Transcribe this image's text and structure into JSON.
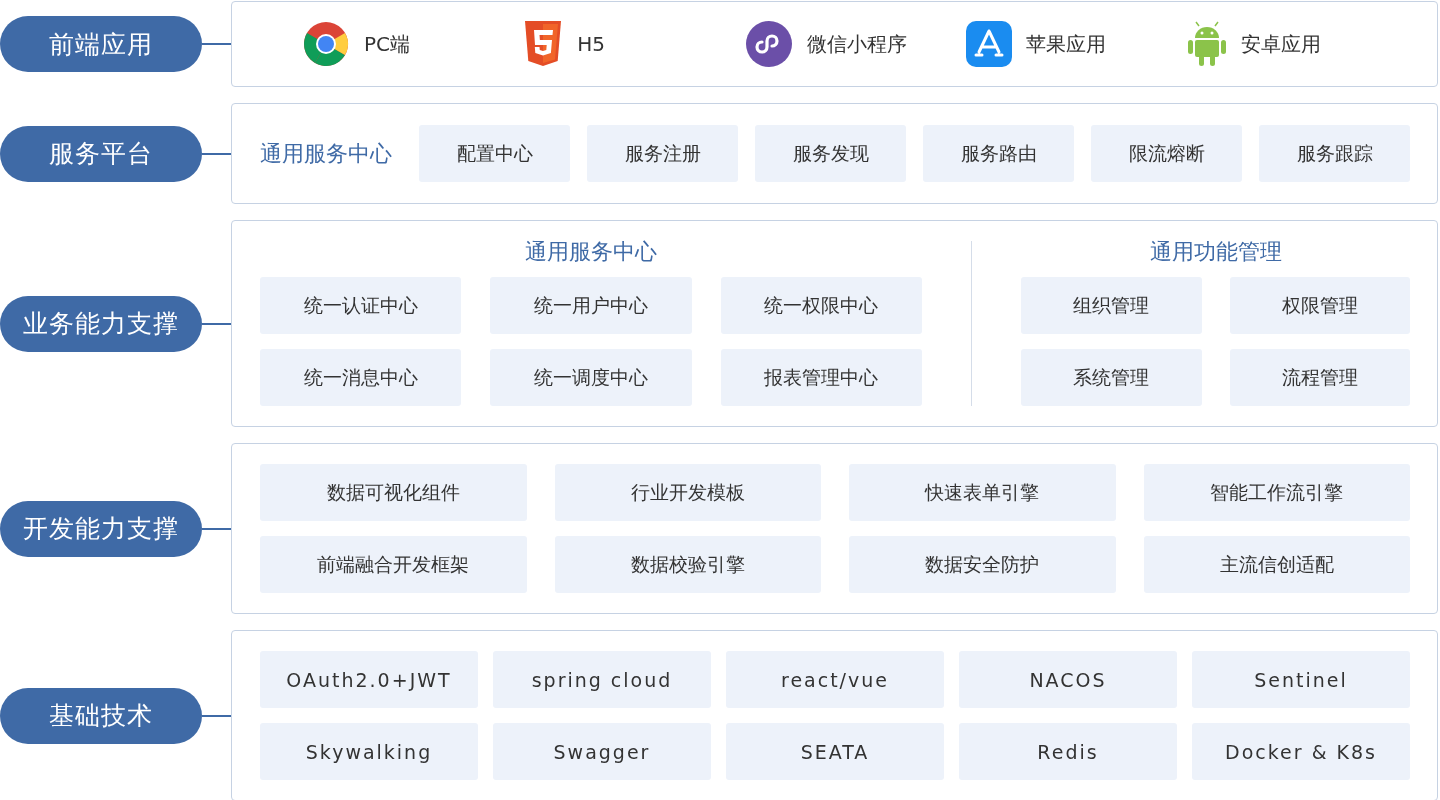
{
  "layers": [
    {
      "kind": "platforms",
      "label": "前端应用",
      "items": [
        "PC端",
        "H5",
        "微信小程序",
        "苹果应用",
        "安卓应用"
      ]
    },
    {
      "kind": "service",
      "label": "服务平台",
      "heading": "通用服务中心",
      "items": [
        "配置中心",
        "服务注册",
        "服务发现",
        "服务路由",
        "限流熔断",
        "服务跟踪"
      ]
    },
    {
      "kind": "business",
      "label": "业务能力支撑",
      "groups": [
        {
          "title": "通用服务中心",
          "items": [
            "统一认证中心",
            "统一用户中心",
            "统一权限中心",
            "统一消息中心",
            "统一调度中心",
            "报表管理中心"
          ]
        },
        {
          "title": "通用功能管理",
          "items": [
            "组织管理",
            "权限管理",
            "系统管理",
            "流程管理"
          ]
        }
      ]
    },
    {
      "kind": "dev",
      "label": "开发能力支撑",
      "items": [
        "数据可视化组件",
        "行业开发模板",
        "快速表单引擎",
        "智能工作流引擎",
        "前端融合开发框架",
        "数据校验引擎",
        "数据安全防护",
        "主流信创适配"
      ]
    },
    {
      "kind": "tech",
      "label": "基础技术",
      "items": [
        "OAuth2.0+JWT",
        "spring cloud",
        "react/vue",
        "NACOS",
        "Sentinel",
        "Skywalking",
        "Swagger",
        "SEATA",
        "Redis",
        "Docker & K8s"
      ]
    }
  ]
}
